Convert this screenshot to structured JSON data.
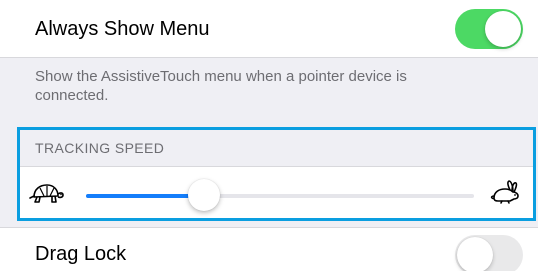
{
  "always_show_menu": {
    "label": "Always Show Menu",
    "toggle_on": true,
    "footer": "Show the AssistiveTouch menu when a pointer device is connected."
  },
  "tracking_speed": {
    "header": "TRACKING SPEED",
    "value": 0.305,
    "min_icon": "turtle-icon",
    "max_icon": "rabbit-icon"
  },
  "drag_lock": {
    "label": "Drag Lock",
    "toggle_on": false
  },
  "colors": {
    "toggle_on": "#4cd964",
    "slider_fill": "#147efb",
    "highlight": "#0a9ee0"
  }
}
